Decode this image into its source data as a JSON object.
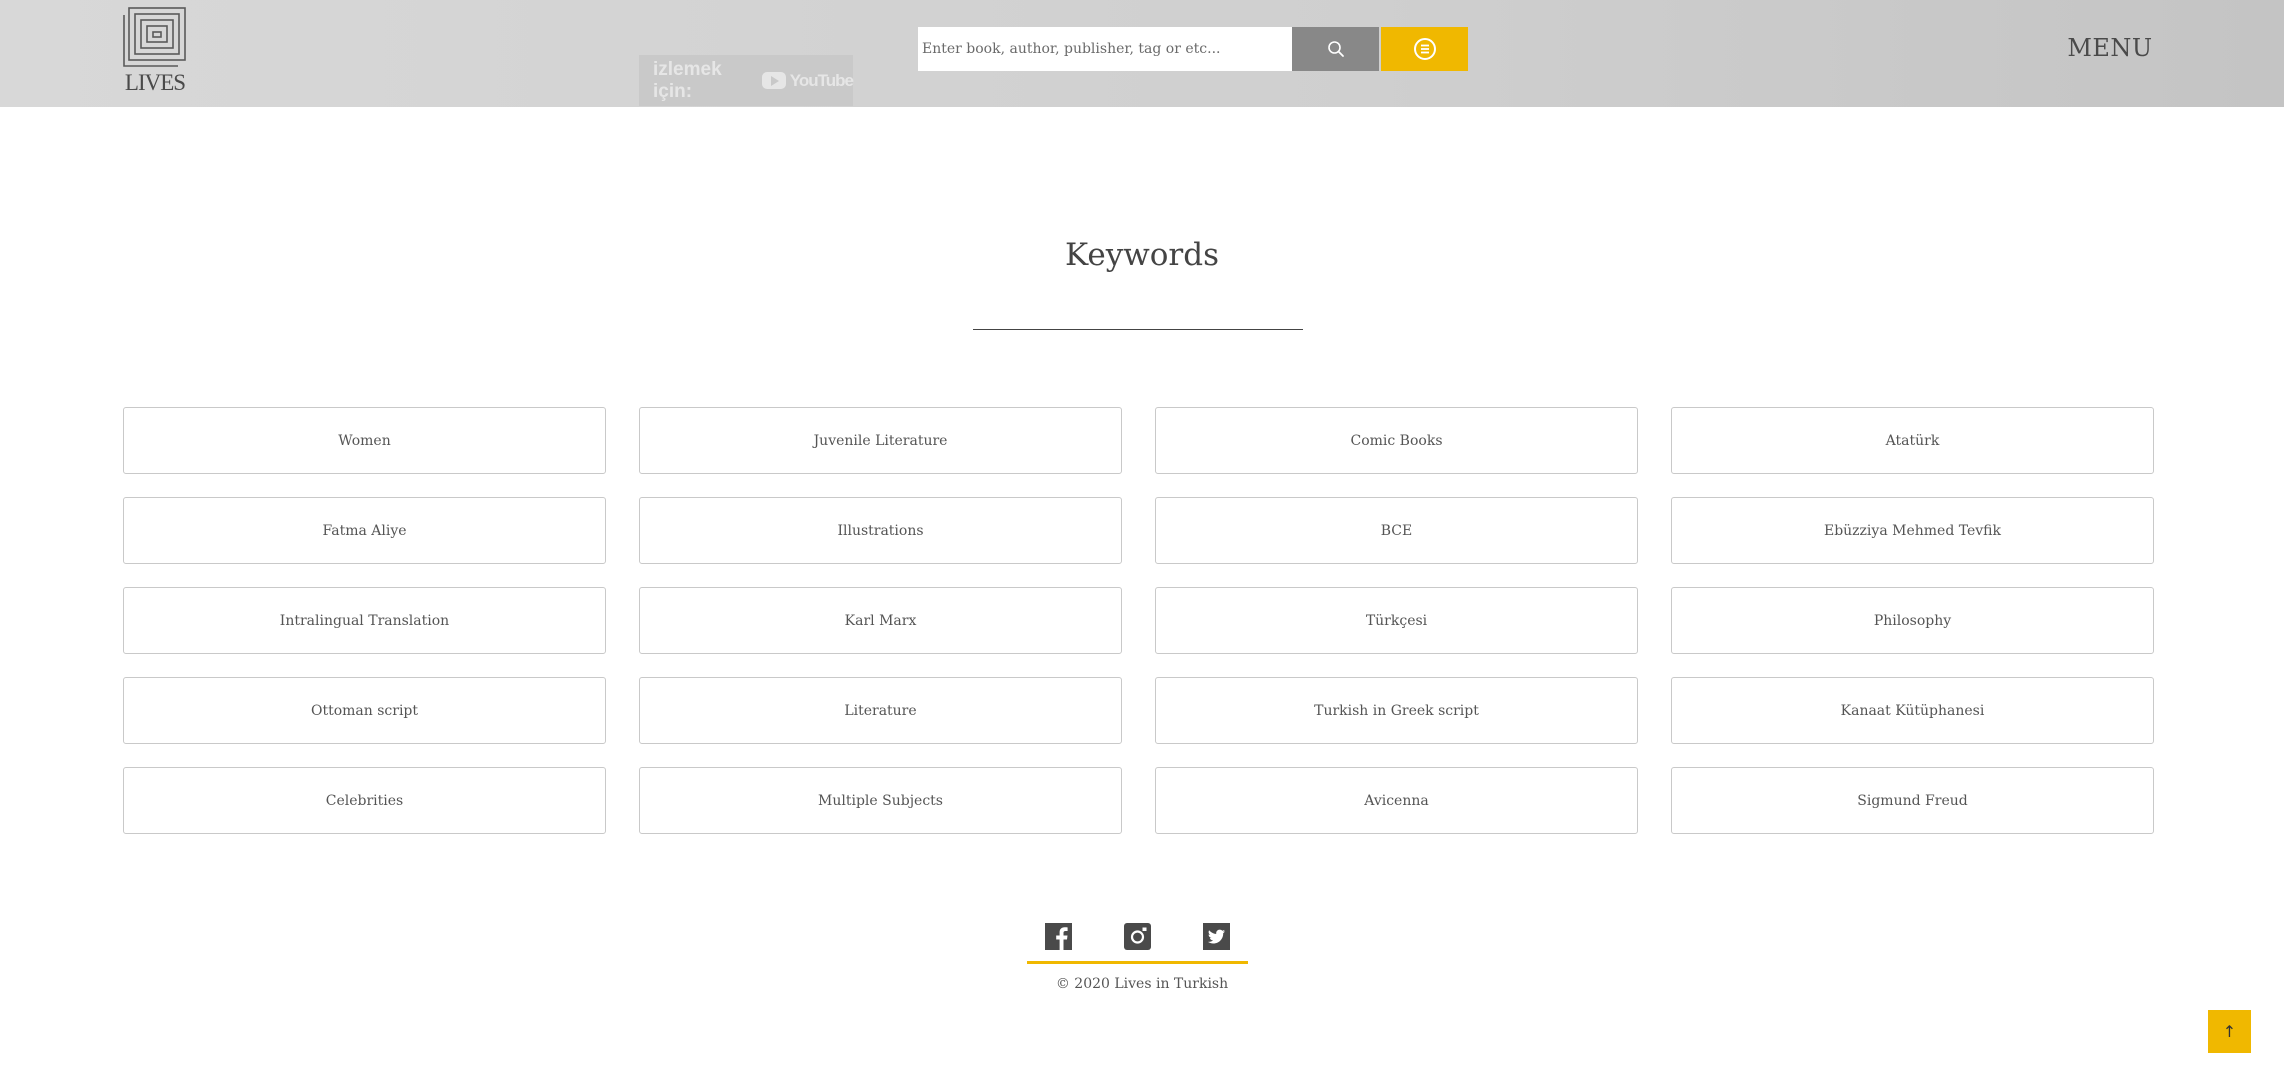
{
  "header": {
    "logo_text": "LIVES",
    "youtube_overlay": {
      "text": "izlemek için:",
      "brand": "YouTube"
    },
    "search": {
      "placeholder": "Enter book, author, publisher, tag or etc..."
    },
    "icons": {
      "search": "search-icon",
      "list": "list-icon"
    },
    "menu_label": "MENU"
  },
  "main": {
    "title": "Keywords",
    "keywords": [
      "Women",
      "Juvenile Literature",
      "Comic Books",
      "Atatürk",
      "Fatma Aliye",
      "Illustrations",
      "BCE",
      "Ebüzziya Mehmed Tevfik",
      "Intralingual Translation",
      "Karl Marx",
      "Türkçesi",
      "Philosophy",
      "Ottoman script",
      "Literature",
      "Turkish in Greek script",
      "Kanaat Kütüphanesi",
      "Celebrities",
      "Multiple Subjects",
      "Avicenna",
      "Sigmund Freud"
    ]
  },
  "footer": {
    "social": [
      "facebook-icon",
      "instagram-icon",
      "twitter-icon"
    ],
    "copyright": "© 2020 Lives in Turkish",
    "back_to_top": "↑"
  },
  "colors": {
    "accent": "#f0b800",
    "header_bg": "#d0d0d0",
    "search_button": "#888888",
    "text": "#555555"
  }
}
